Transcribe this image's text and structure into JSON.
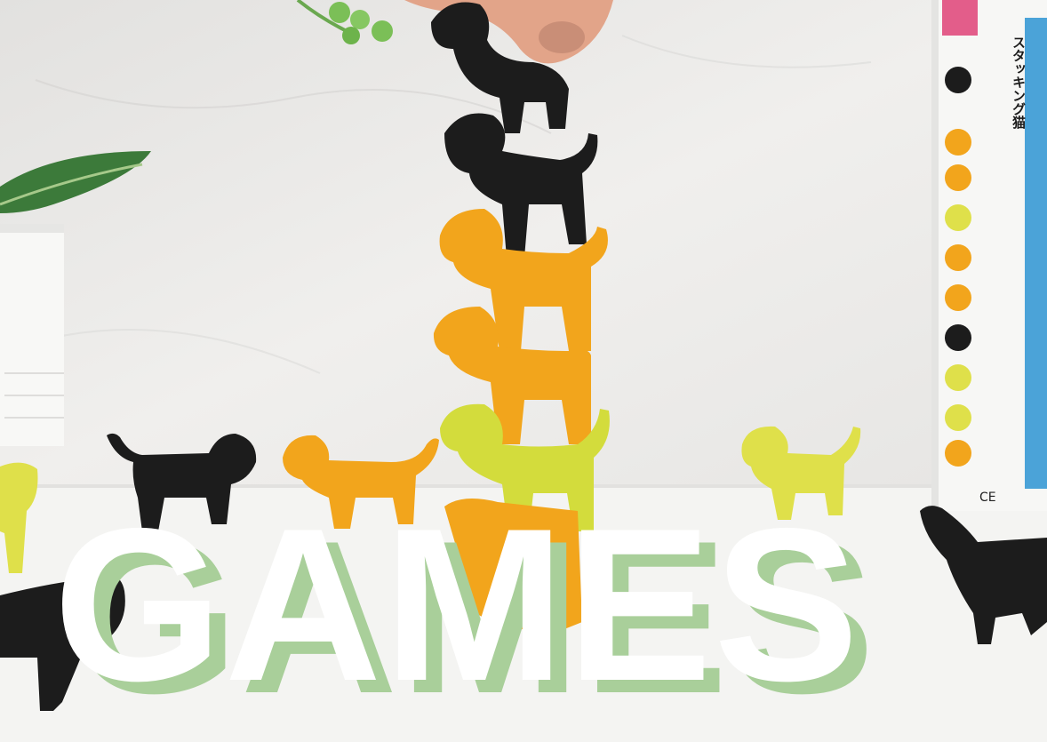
{
  "banner": {
    "title": "GAMES",
    "title_color": "#ffffff",
    "title_shadow_color": "#a9cf9a"
  },
  "product_box": {
    "name": "スタッキング猫",
    "mark": "CE"
  },
  "photo": {
    "icons": [
      "cat-figure-icon",
      "plant-icon",
      "hand-icon"
    ],
    "colors": {
      "black_cat": "#1c1c1c",
      "orange_cat": "#f2a51c",
      "yellow_cat": "#dfe04a",
      "lime_cat": "#d3dc3c"
    }
  }
}
